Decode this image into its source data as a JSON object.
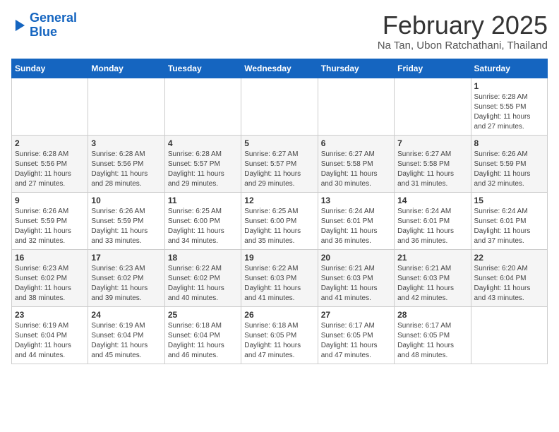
{
  "logo": {
    "line1": "General",
    "line2": "Blue"
  },
  "header": {
    "month": "February 2025",
    "location": "Na Tan, Ubon Ratchathani, Thailand"
  },
  "weekdays": [
    "Sunday",
    "Monday",
    "Tuesday",
    "Wednesday",
    "Thursday",
    "Friday",
    "Saturday"
  ],
  "weeks": [
    [
      {
        "day": "",
        "info": ""
      },
      {
        "day": "",
        "info": ""
      },
      {
        "day": "",
        "info": ""
      },
      {
        "day": "",
        "info": ""
      },
      {
        "day": "",
        "info": ""
      },
      {
        "day": "",
        "info": ""
      },
      {
        "day": "1",
        "info": "Sunrise: 6:28 AM\nSunset: 5:55 PM\nDaylight: 11 hours\nand 27 minutes."
      }
    ],
    [
      {
        "day": "2",
        "info": "Sunrise: 6:28 AM\nSunset: 5:56 PM\nDaylight: 11 hours\nand 27 minutes."
      },
      {
        "day": "3",
        "info": "Sunrise: 6:28 AM\nSunset: 5:56 PM\nDaylight: 11 hours\nand 28 minutes."
      },
      {
        "day": "4",
        "info": "Sunrise: 6:28 AM\nSunset: 5:57 PM\nDaylight: 11 hours\nand 29 minutes."
      },
      {
        "day": "5",
        "info": "Sunrise: 6:27 AM\nSunset: 5:57 PM\nDaylight: 11 hours\nand 29 minutes."
      },
      {
        "day": "6",
        "info": "Sunrise: 6:27 AM\nSunset: 5:58 PM\nDaylight: 11 hours\nand 30 minutes."
      },
      {
        "day": "7",
        "info": "Sunrise: 6:27 AM\nSunset: 5:58 PM\nDaylight: 11 hours\nand 31 minutes."
      },
      {
        "day": "8",
        "info": "Sunrise: 6:26 AM\nSunset: 5:59 PM\nDaylight: 11 hours\nand 32 minutes."
      }
    ],
    [
      {
        "day": "9",
        "info": "Sunrise: 6:26 AM\nSunset: 5:59 PM\nDaylight: 11 hours\nand 32 minutes."
      },
      {
        "day": "10",
        "info": "Sunrise: 6:26 AM\nSunset: 5:59 PM\nDaylight: 11 hours\nand 33 minutes."
      },
      {
        "day": "11",
        "info": "Sunrise: 6:25 AM\nSunset: 6:00 PM\nDaylight: 11 hours\nand 34 minutes."
      },
      {
        "day": "12",
        "info": "Sunrise: 6:25 AM\nSunset: 6:00 PM\nDaylight: 11 hours\nand 35 minutes."
      },
      {
        "day": "13",
        "info": "Sunrise: 6:24 AM\nSunset: 6:01 PM\nDaylight: 11 hours\nand 36 minutes."
      },
      {
        "day": "14",
        "info": "Sunrise: 6:24 AM\nSunset: 6:01 PM\nDaylight: 11 hours\nand 36 minutes."
      },
      {
        "day": "15",
        "info": "Sunrise: 6:24 AM\nSunset: 6:01 PM\nDaylight: 11 hours\nand 37 minutes."
      }
    ],
    [
      {
        "day": "16",
        "info": "Sunrise: 6:23 AM\nSunset: 6:02 PM\nDaylight: 11 hours\nand 38 minutes."
      },
      {
        "day": "17",
        "info": "Sunrise: 6:23 AM\nSunset: 6:02 PM\nDaylight: 11 hours\nand 39 minutes."
      },
      {
        "day": "18",
        "info": "Sunrise: 6:22 AM\nSunset: 6:02 PM\nDaylight: 11 hours\nand 40 minutes."
      },
      {
        "day": "19",
        "info": "Sunrise: 6:22 AM\nSunset: 6:03 PM\nDaylight: 11 hours\nand 41 minutes."
      },
      {
        "day": "20",
        "info": "Sunrise: 6:21 AM\nSunset: 6:03 PM\nDaylight: 11 hours\nand 41 minutes."
      },
      {
        "day": "21",
        "info": "Sunrise: 6:21 AM\nSunset: 6:03 PM\nDaylight: 11 hours\nand 42 minutes."
      },
      {
        "day": "22",
        "info": "Sunrise: 6:20 AM\nSunset: 6:04 PM\nDaylight: 11 hours\nand 43 minutes."
      }
    ],
    [
      {
        "day": "23",
        "info": "Sunrise: 6:19 AM\nSunset: 6:04 PM\nDaylight: 11 hours\nand 44 minutes."
      },
      {
        "day": "24",
        "info": "Sunrise: 6:19 AM\nSunset: 6:04 PM\nDaylight: 11 hours\nand 45 minutes."
      },
      {
        "day": "25",
        "info": "Sunrise: 6:18 AM\nSunset: 6:04 PM\nDaylight: 11 hours\nand 46 minutes."
      },
      {
        "day": "26",
        "info": "Sunrise: 6:18 AM\nSunset: 6:05 PM\nDaylight: 11 hours\nand 47 minutes."
      },
      {
        "day": "27",
        "info": "Sunrise: 6:17 AM\nSunset: 6:05 PM\nDaylight: 11 hours\nand 47 minutes."
      },
      {
        "day": "28",
        "info": "Sunrise: 6:17 AM\nSunset: 6:05 PM\nDaylight: 11 hours\nand 48 minutes."
      },
      {
        "day": "",
        "info": ""
      }
    ]
  ]
}
